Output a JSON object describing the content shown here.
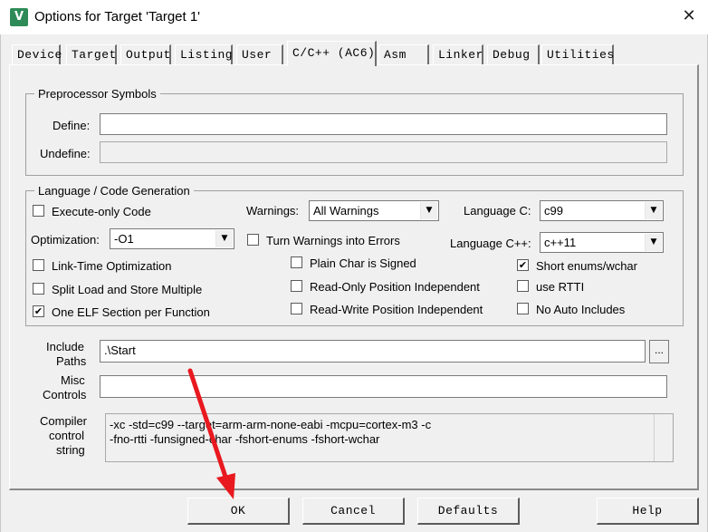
{
  "window": {
    "title": "Options for Target 'Target 1'",
    "close_glyph": "✕",
    "app_icon_glyph": "V"
  },
  "tabs": [
    {
      "label": "Device"
    },
    {
      "label": "Target"
    },
    {
      "label": "Output"
    },
    {
      "label": "Listing"
    },
    {
      "label": "User"
    },
    {
      "label": "C/C++ (AC6)"
    },
    {
      "label": "Asm"
    },
    {
      "label": "Linker"
    },
    {
      "label": "Debug"
    },
    {
      "label": "Utilities"
    }
  ],
  "preprocessor": {
    "title": "Preprocessor Symbols",
    "define_label": "Define:",
    "define_value": "",
    "undefine_label": "Undefine:",
    "undefine_value": ""
  },
  "language": {
    "title": "Language / Code Generation",
    "execute_only": {
      "label": "Execute-only Code",
      "checked": false
    },
    "warnings_label": "Warnings:",
    "warnings_value": "All Warnings",
    "language_c_label": "Language C:",
    "language_c_value": "c99",
    "optimization_label": "Optimization:",
    "optimization_value": "-O1",
    "turn_warnings_errors": {
      "label": "Turn Warnings into Errors",
      "checked": false
    },
    "language_cpp_label": "Language C++:",
    "language_cpp_value": "c++11",
    "link_time": {
      "label": "Link-Time Optimization",
      "checked": false
    },
    "plain_char": {
      "label": "Plain Char is Signed",
      "checked": false
    },
    "short_enums": {
      "label": "Short enums/wchar",
      "checked": true
    },
    "split_load": {
      "label": "Split Load and Store Multiple",
      "checked": false
    },
    "ropi": {
      "label": "Read-Only Position Independent",
      "checked": false
    },
    "rtti": {
      "label": "use RTTI",
      "checked": false
    },
    "one_elf": {
      "label": "One ELF Section per Function",
      "checked": true
    },
    "rwpi": {
      "label": "Read-Write Position Independent",
      "checked": false
    },
    "no_auto": {
      "label": "No Auto Includes",
      "checked": false
    }
  },
  "include": {
    "label_line1": "Include",
    "label_line2": "Paths",
    "value": ".\\Start",
    "browse_label": "..."
  },
  "misc": {
    "label_line1": "Misc",
    "label_line2": "Controls",
    "value": ""
  },
  "compiler": {
    "label_line1": "Compiler",
    "label_line2": "control",
    "label_line3": "string",
    "line1": "-xc -std=c99 --target=arm-arm-none-eabi -mcpu=cortex-m3 -c",
    "line2": "-fno-rtti -funsigned-char -fshort-enums -fshort-wchar"
  },
  "buttons": {
    "ok": "OK",
    "cancel": "Cancel",
    "defaults": "Defaults",
    "help": "Help"
  },
  "icons": {
    "checkmark": "✔",
    "dropdown": "▼"
  },
  "colors": {
    "dialog_bg": "#f0f0f0",
    "annotation_arrow": "#e8191f",
    "app_icon": "#2e8b57"
  }
}
